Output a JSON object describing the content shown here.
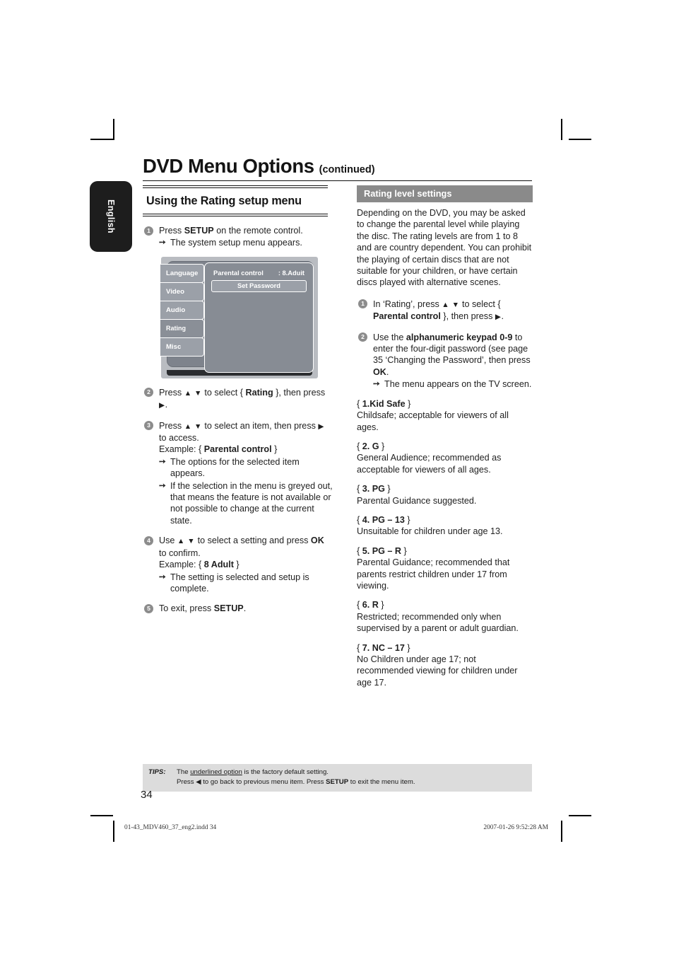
{
  "side_tab": {
    "label": "English"
  },
  "header": {
    "title": "DVD Menu Options",
    "continued": "(continued)"
  },
  "left": {
    "section_heading": "Using the Rating setup menu",
    "step1": {
      "num": "1",
      "text_a": "Press ",
      "bold_a": "SETUP",
      "text_b": " on the remote control.",
      "sub1": "The system setup menu appears."
    },
    "tv_menu": {
      "tabs": [
        "Language",
        "Video",
        "Audio",
        "Rating",
        "Misc"
      ],
      "selected_tab": "Rating",
      "row_label": "Parental control",
      "row_value": ": 8.Aduit",
      "button": "Set Password"
    },
    "step2": {
      "num": "2",
      "text_a": "Press ",
      "arrows": "▲ ▼",
      "text_b": " to select { ",
      "bold_a": "Rating",
      "text_c": " }, then press ",
      "arrow_right": "▶",
      "text_d": "."
    },
    "step3": {
      "num": "3",
      "text_a": "Press ",
      "arrows": "▲ ▼",
      "text_b": " to select an item, then press ",
      "arrow_right": "▶",
      "text_c": " to access.",
      "example_label": "Example: { ",
      "example_bold": "Parental control",
      "example_end": " }",
      "sub1": "The options for the selected item appears.",
      "sub2": "If the selection in the menu is greyed out, that means the feature is not available or not possible to change at the current state."
    },
    "step4": {
      "num": "4",
      "text_a": "Use ",
      "arrows": "▲ ▼",
      "text_b": " to select a setting and press ",
      "bold_a": "OK",
      "text_c": " to confirm.",
      "example_label": "Example: { ",
      "example_bold": "8 Adult",
      "example_end": " }",
      "sub1": "The setting is selected and setup is complete."
    },
    "step5": {
      "num": "5",
      "text_a": "To exit, press ",
      "bold_a": "SETUP",
      "text_b": "."
    }
  },
  "right": {
    "bar_title": "Rating level settings",
    "intro": "Depending on the DVD, you may be asked to change the parental level while playing the disc. The rating levels are from 1 to 8 and are country dependent. You can prohibit the playing of certain discs that are not suitable for your children, or have certain discs played with alternative scenes.",
    "step1": {
      "num": "1",
      "text_a": "In ‘Rating’, press ",
      "arrows": "▲ ▼",
      "text_b": " to select { ",
      "bold_a": "Parental control",
      "text_c": " }, then press ",
      "arrow_right": "▶",
      "text_d": "."
    },
    "step2": {
      "num": "2",
      "text_a": "Use the ",
      "bold_a": "alphanumeric keypad 0-9",
      "text_b": " to enter the four-digit password (see page 35 ‘Changing the Password’, then press ",
      "bold_b": "OK",
      "text_c": ".",
      "sub1": "The menu appears on the TV screen."
    },
    "levels": [
      {
        "key_open": "{ ",
        "key_bold": "1.Kid Safe",
        "key_close": " }",
        "desc": "Childsafe; acceptable for viewers of all ages."
      },
      {
        "key_open": "{ ",
        "key_bold": "2. G",
        "key_close": " }",
        "desc": "General Audience; recommended as acceptable for viewers of all ages."
      },
      {
        "key_open": "{ ",
        "key_bold": "3. PG",
        "key_close": " }",
        "desc": "Parental Guidance suggested."
      },
      {
        "key_open": "{ ",
        "key_bold": "4. PG – 13",
        "key_close": " }",
        "desc": "Unsuitable for children under age 13."
      },
      {
        "key_open": "{ ",
        "key_bold": "5. PG – R",
        "key_close": " }",
        "desc": "Parental Guidance; recommended that parents restrict children under 17 from viewing."
      },
      {
        "key_open": "{ ",
        "key_bold": "6. R",
        "key_close": " }",
        "desc": "Restricted; recommended only when supervised by a parent or adult guardian."
      },
      {
        "key_open": "{ ",
        "key_bold": "7. NC – 17",
        "key_close": " }",
        "desc": "No Children under age 17; not recommended viewing for children under age 17."
      }
    ]
  },
  "tips": {
    "label": "TIPS:",
    "line1_a": "The ",
    "line1_u": "underlined option",
    "line1_b": " is the factory default setting.",
    "line2_a": "Press ",
    "line2_arrow": "◀",
    "line2_b": " to go back to previous menu item. Press ",
    "line2_bold": "SETUP",
    "line2_c": " to exit the menu item."
  },
  "page_number": "34",
  "print_footer": {
    "file": "01-43_MDV460_37_eng2.indd   34",
    "date": "2007-01-26   9:52:28 AM"
  }
}
